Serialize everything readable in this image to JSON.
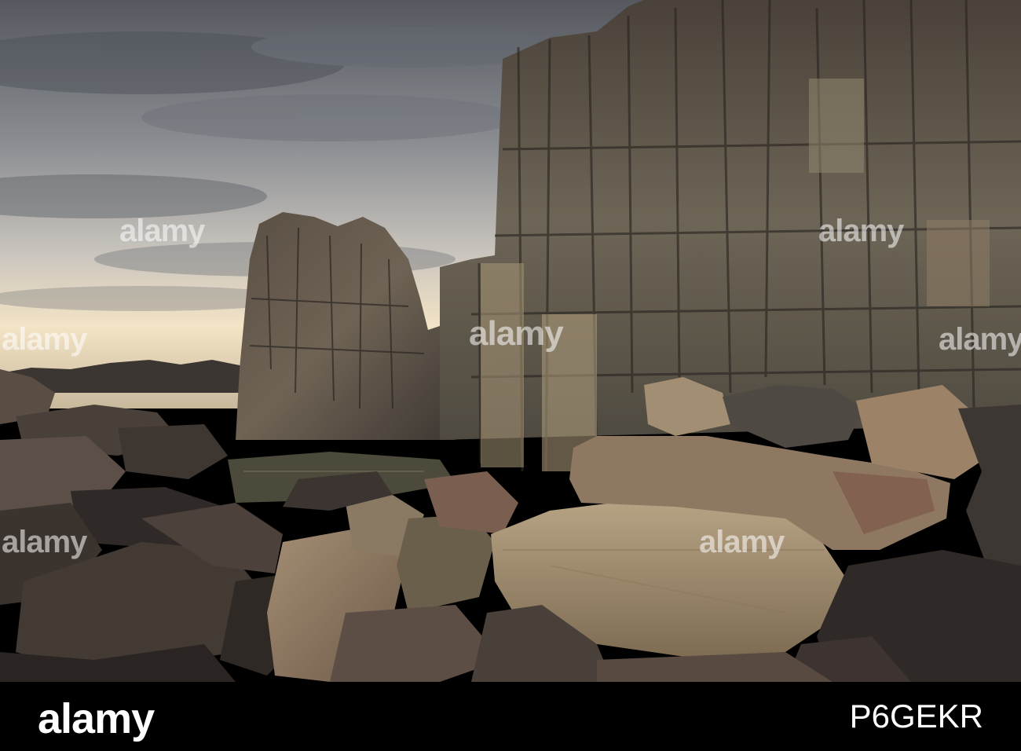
{
  "image": {
    "alt": "Basalt rock columns and boulders on a rocky coastline under a cloudy sky"
  },
  "watermarks": [
    "alamy",
    "alamy",
    "alamy",
    "alamy",
    "alamy",
    "alamy",
    "alamy"
  ],
  "footer": {
    "logo": "alamy",
    "image_id": "P6GEKR"
  },
  "colors": {
    "sky_top": "#5f636c",
    "sky_horizon": "#f2e2c4",
    "rock_dark": "#3a3530",
    "rock_mid": "#6b5f50",
    "rock_light": "#a4916f",
    "water": "#4c4a3a",
    "footer_bg": "#000000"
  }
}
